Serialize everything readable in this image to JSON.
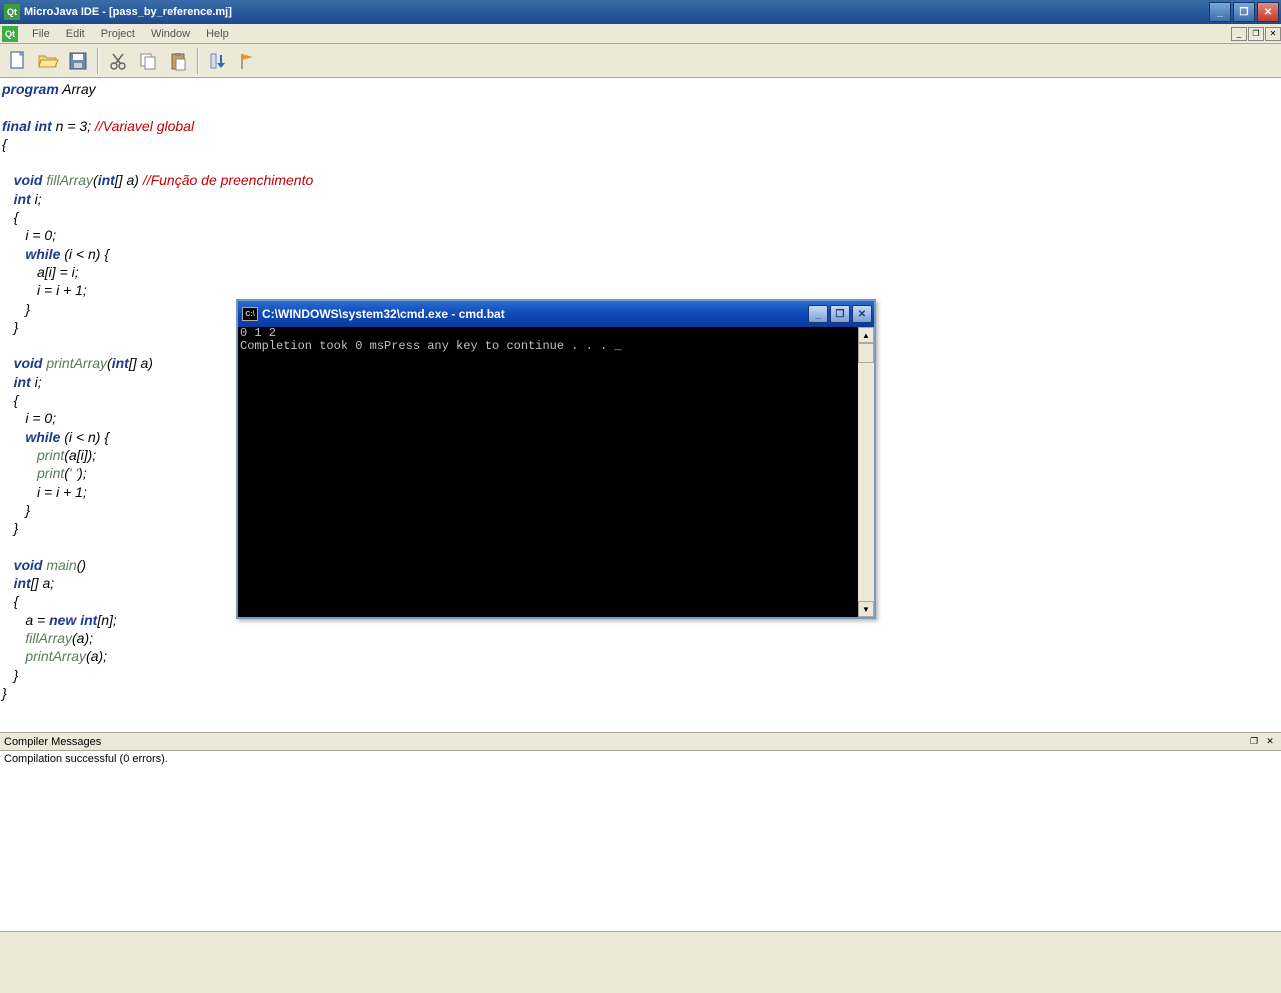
{
  "window": {
    "title": "MicroJava IDE - [pass_by_reference.mj]",
    "app_icon_label": "Qt"
  },
  "menu": {
    "file": "File",
    "edit": "Edit",
    "project": "Project",
    "window": "Window",
    "help": "Help"
  },
  "code": {
    "l01_kw": "program",
    "l01_rest": " Array",
    "l02": "",
    "l03_kw": "final int",
    "l03_rest": " n = 3; ",
    "l03_cm": "//Variavel global",
    "l04": "{",
    "l05": "",
    "l06_pad": "   ",
    "l06_kw": "void",
    "l06_sp": " ",
    "l06_fn": "fillArray",
    "l06_p1": "(",
    "l06_t": "int",
    "l06_p2": "[] a) ",
    "l06_cm": "//Função de preenchimento",
    "l07_pad": "   ",
    "l07_kw": "int",
    "l07_rest": " i;",
    "l08": "   {",
    "l09": "      i = 0;",
    "l10_pad": "      ",
    "l10_kw": "while",
    "l10_rest": " (i < n) {",
    "l11": "         a[i] = i;",
    "l12": "         i = i + 1;",
    "l13": "      }",
    "l14": "   }",
    "l15": "",
    "l16_pad": "   ",
    "l16_kw": "void",
    "l16_sp": " ",
    "l16_fn": "printArray",
    "l16_p1": "(",
    "l16_t": "int",
    "l16_p2": "[] a)",
    "l17_pad": "   ",
    "l17_kw": "int",
    "l17_rest": " i;",
    "l18": "   {",
    "l19": "      i = 0;",
    "l20_pad": "      ",
    "l20_kw": "while",
    "l20_rest": " (i < n) {",
    "l21_pad": "         ",
    "l21_fn": "print",
    "l21_rest": "(a[i]);",
    "l22_pad": "         ",
    "l22_fn": "print",
    "l22_p1": "(",
    "l22_str": "' '",
    "l22_p2": ");",
    "l23": "         i = i + 1;",
    "l24": "      }",
    "l25": "   }",
    "l26": "",
    "l27_pad": "   ",
    "l27_kw": "void",
    "l27_sp": " ",
    "l27_fn": "main",
    "l27_rest": "()",
    "l28_pad": "   ",
    "l28_kw": "int",
    "l28_rest": "[] a;",
    "l29": "   {",
    "l30_pad": "      a = ",
    "l30_kw": "new int",
    "l30_rest": "[n];",
    "l31_pad": "      ",
    "l31_fn": "fillArray",
    "l31_rest": "(a);",
    "l32_pad": "      ",
    "l32_fn": "printArray",
    "l32_rest": "(a);",
    "l33": "   }",
    "l34": "}"
  },
  "compiler": {
    "title": "Compiler Messages",
    "message": "Compilation successful (0 errors)."
  },
  "console": {
    "title": "C:\\WINDOWS\\system32\\cmd.exe - cmd.bat",
    "icon_text": "C:\\",
    "line1": "0 1 2",
    "line2": "Completion took 0 msPress any key to continue . . . _"
  }
}
